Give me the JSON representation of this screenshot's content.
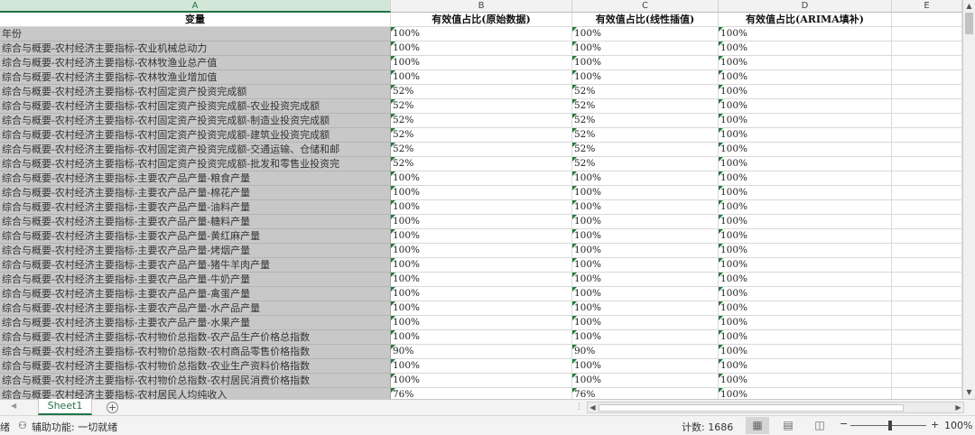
{
  "columns": [
    "A",
    "B",
    "C",
    "D",
    "E"
  ],
  "header": [
    "变量",
    "有效值占比(原始数据)",
    "有效值占比(线性插值)",
    "有效值占比(ARIMA填补)"
  ],
  "rows": [
    [
      "年份",
      "100%",
      "100%",
      "100%"
    ],
    [
      "综合与概要-农村经济主要指标-农业机械总动力",
      "100%",
      "100%",
      "100%"
    ],
    [
      "综合与概要-农村经济主要指标-农林牧渔业总产值",
      "100%",
      "100%",
      "100%"
    ],
    [
      "综合与概要-农村经济主要指标-农林牧渔业增加值",
      "100%",
      "100%",
      "100%"
    ],
    [
      "综合与概要-农村经济主要指标-农村固定资产投资完成额",
      "52%",
      "52%",
      "100%"
    ],
    [
      "综合与概要-农村经济主要指标-农村固定资产投资完成额-农业投资完成额",
      "52%",
      "52%",
      "100%"
    ],
    [
      "综合与概要-农村经济主要指标-农村固定资产投资完成额-制造业投资完成额",
      "52%",
      "52%",
      "100%"
    ],
    [
      "综合与概要-农村经济主要指标-农村固定资产投资完成额-建筑业投资完成额",
      "52%",
      "52%",
      "100%"
    ],
    [
      "综合与概要-农村经济主要指标-农村固定资产投资完成额-交通运输、仓储和邮",
      "52%",
      "52%",
      "100%"
    ],
    [
      "综合与概要-农村经济主要指标-农村固定资产投资完成额-批发和零售业投资完",
      "52%",
      "52%",
      "100%"
    ],
    [
      "综合与概要-农村经济主要指标-主要农产品产量-粮食产量",
      "100%",
      "100%",
      "100%"
    ],
    [
      "综合与概要-农村经济主要指标-主要农产品产量-棉花产量",
      "100%",
      "100%",
      "100%"
    ],
    [
      "综合与概要-农村经济主要指标-主要农产品产量-油料产量",
      "100%",
      "100%",
      "100%"
    ],
    [
      "综合与概要-农村经济主要指标-主要农产品产量-糖料产量",
      "100%",
      "100%",
      "100%"
    ],
    [
      "综合与概要-农村经济主要指标-主要农产品产量-黄红麻产量",
      "100%",
      "100%",
      "100%"
    ],
    [
      "综合与概要-农村经济主要指标-主要农产品产量-烤烟产量",
      "100%",
      "100%",
      "100%"
    ],
    [
      "综合与概要-农村经济主要指标-主要农产品产量-猪牛羊肉产量",
      "100%",
      "100%",
      "100%"
    ],
    [
      "综合与概要-农村经济主要指标-主要农产品产量-牛奶产量",
      "100%",
      "100%",
      "100%"
    ],
    [
      "综合与概要-农村经济主要指标-主要农产品产量-禽蛋产量",
      "100%",
      "100%",
      "100%"
    ],
    [
      "综合与概要-农村经济主要指标-主要农产品产量-水产品产量",
      "100%",
      "100%",
      "100%"
    ],
    [
      "综合与概要-农村经济主要指标-主要农产品产量-水果产量",
      "100%",
      "100%",
      "100%"
    ],
    [
      "综合与概要-农村经济主要指标-农村物价总指数-农产品生产价格总指数",
      "100%",
      "100%",
      "100%"
    ],
    [
      "综合与概要-农村经济主要指标-农村物价总指数-农村商品零售价格指数",
      "90%",
      "90%",
      "100%"
    ],
    [
      "综合与概要-农村经济主要指标-农村物价总指数-农业生产资料价格指数",
      "100%",
      "100%",
      "100%"
    ],
    [
      "综合与概要-农村经济主要指标-农村物价总指数-农村居民消费价格指数",
      "100%",
      "100%",
      "100%"
    ],
    [
      "综合与概要-农村经济主要指标-农村居民人均纯收入",
      "76%",
      "76%",
      "100%"
    ]
  ],
  "sheet_tab": "Sheet1",
  "add_sheet": "+",
  "status": {
    "left_text": "绪",
    "accessibility": "辅助功能: 一切就绪",
    "count": "计数: 1686",
    "zoom_minus": "−",
    "zoom_plus": "+",
    "zoom": "100%"
  },
  "icons": {
    "accessibility": "accessibility-icon",
    "normal_view": "normal-view-icon",
    "page_layout": "page-layout-icon",
    "page_break": "page-break-preview-icon"
  },
  "colors": {
    "accent": "#217346",
    "column_a_fill": "#c8c8c8"
  }
}
